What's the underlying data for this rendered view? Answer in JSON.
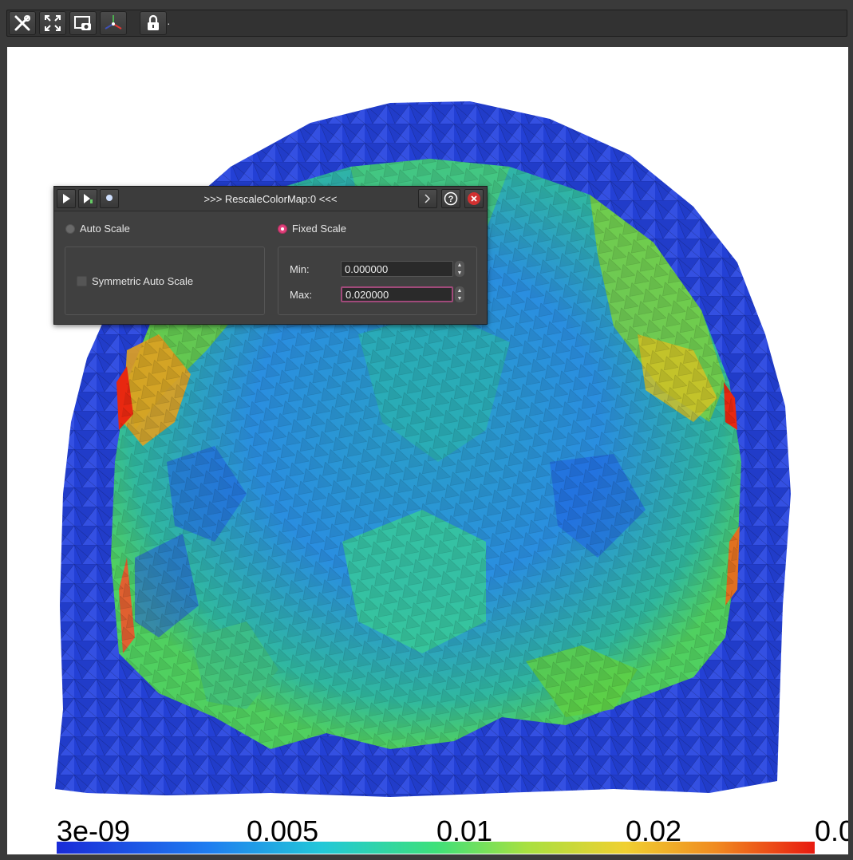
{
  "toolbar": {
    "buttons": [
      {
        "name": "tools-icon"
      },
      {
        "name": "fullscreen-icon"
      },
      {
        "name": "screenshot-icon"
      },
      {
        "name": "axes-orientation-icon"
      },
      {
        "name": "lock-icon"
      }
    ],
    "trailing_text": "·"
  },
  "legend": {
    "labels": [
      "3e-09",
      "0.005",
      "0.01",
      "0.02",
      "0.0"
    ],
    "colors": [
      "#1a2bd8",
      "#1f7df0",
      "#22c8d8",
      "#3de07a",
      "#a8e040",
      "#f0d030",
      "#f08a20",
      "#e81a10"
    ]
  },
  "dialog": {
    "title": ">>> RescaleColorMap:0 <<<",
    "auto_scale_label": "Auto Scale",
    "fixed_scale_label": "Fixed Scale",
    "symmetric_label": "Symmetric Auto Scale",
    "min_label": "Min:",
    "min_value": "0.000000",
    "max_label": "Max:",
    "max_value": "0.020000",
    "selected_mode": "fixed"
  }
}
